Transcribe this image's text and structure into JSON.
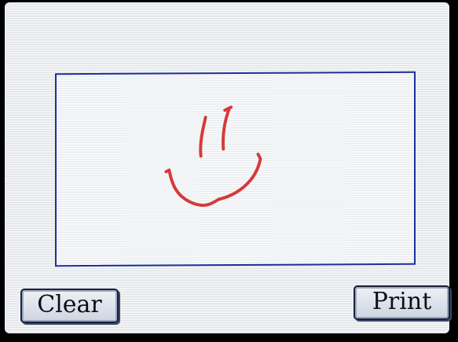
{
  "buttons": {
    "clear_label": "Clear",
    "print_label": "Print"
  },
  "colors": {
    "canvas_border": "#1c2f9a",
    "ink": "#d43a3a",
    "screen_bg": "#eceef0"
  },
  "drawing": {
    "ink_color": "#d43a3a"
  }
}
